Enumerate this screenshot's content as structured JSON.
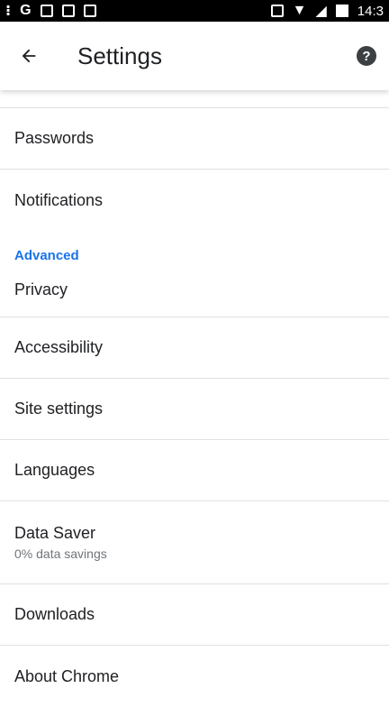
{
  "status_bar": {
    "time": "14:3"
  },
  "app_bar": {
    "title": "Settings",
    "help_glyph": "?"
  },
  "list": {
    "items_before": [
      {
        "label": "Passwords"
      },
      {
        "label": "Notifications"
      }
    ],
    "section_header": "Advanced",
    "items_after": [
      {
        "label": "Privacy"
      },
      {
        "label": "Accessibility"
      },
      {
        "label": "Site settings"
      },
      {
        "label": "Languages"
      },
      {
        "label": "Data Saver",
        "sub": "0% data savings"
      },
      {
        "label": "Downloads"
      },
      {
        "label": "About Chrome"
      }
    ]
  },
  "colors": {
    "accent": "#1a73e8",
    "divider": "#e0e0e0",
    "status_bar": "#000000"
  },
  "icons": [
    "back-arrow-icon",
    "help-icon",
    "notification-icon",
    "google-icon",
    "gmail-icon",
    "image-icon",
    "clipboard-icon",
    "vibrate-icon",
    "wifi-icon",
    "signal-icon",
    "battery-icon"
  ]
}
